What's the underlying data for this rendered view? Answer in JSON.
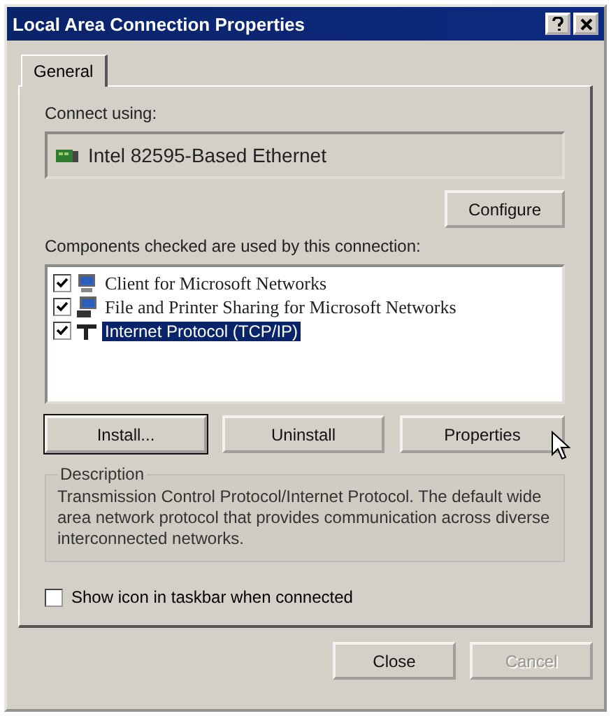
{
  "window": {
    "title": "Local Area Connection Properties"
  },
  "tabs": [
    {
      "label": "General",
      "selected": true
    }
  ],
  "connect_using": {
    "label": "Connect using:",
    "adapter": "Intel 82595-Based Ethernet",
    "configure_button": "Configure"
  },
  "components": {
    "label": "Components checked are used by this connection:",
    "items": [
      {
        "kind": "client",
        "label": "Client for Microsoft Networks",
        "checked": true,
        "selected": false
      },
      {
        "kind": "service",
        "label": "File and Printer Sharing for Microsoft Networks",
        "checked": true,
        "selected": false
      },
      {
        "kind": "protocol",
        "label": "Internet Protocol (TCP/IP)",
        "checked": true,
        "selected": true
      }
    ]
  },
  "component_buttons": [
    {
      "label": "Install...",
      "default": true
    },
    {
      "label": "Uninstall",
      "default": false
    },
    {
      "label": "Properties",
      "default": false
    }
  ],
  "description": {
    "title": "Description",
    "text": "Transmission Control Protocol/Internet Protocol. The default wide area network protocol that provides communication across diverse interconnected networks."
  },
  "show_icon": {
    "label": "Show icon in taskbar when connected",
    "checked": false
  },
  "dialog_buttons": [
    {
      "label": "Close",
      "disabled": false
    },
    {
      "label": "Cancel",
      "disabled": true
    }
  ]
}
